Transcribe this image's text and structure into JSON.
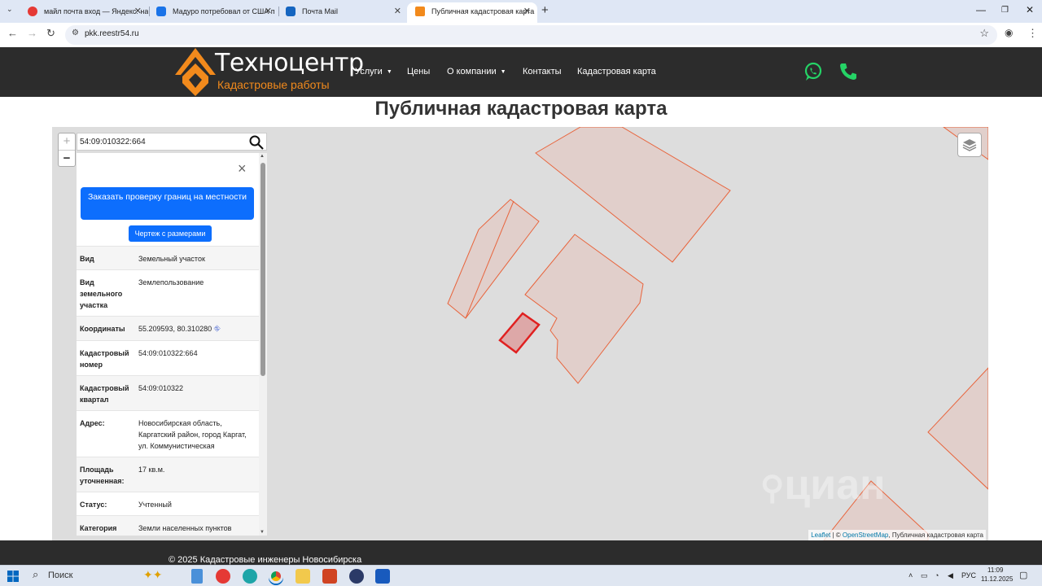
{
  "browser": {
    "tabs": [
      {
        "title": "майл почта вход — Яндекс: на",
        "favicon_color": "#e53935"
      },
      {
        "title": "Мадуро потребовал от США п",
        "favicon_color": "#1a73e8"
      },
      {
        "title": "Почта Mail",
        "favicon_color": "#1565c0"
      },
      {
        "title": "Публичная кадастровая карта",
        "favicon_color": "#f28a1c"
      }
    ],
    "new_tab": "+",
    "url": "pkk.reestr54.ru"
  },
  "site": {
    "logo_title": "Техноцентр",
    "logo_subtitle": "Кадастровые работы",
    "menu": [
      "Услуги",
      "Цены",
      "О компании",
      "Контакты",
      "Кадастровая карта"
    ],
    "page_title": "Публичная кадастровая карта",
    "footer": "© 2025 Кадастровые инженеры Новосибирска"
  },
  "map": {
    "zoom_in": "+",
    "zoom_out": "−",
    "search_value": "54:09:010322:664",
    "watermark": "циан",
    "attribution": {
      "leaflet": "Leaflet",
      "sep": " | © ",
      "osm": "OpenStreetMap",
      "rest": ", Публичная кадастровая карта"
    }
  },
  "panel": {
    "close": "×",
    "order_button": "Заказать проверку границ на местности",
    "drawing_button": "Чертеж с размерами",
    "rows": [
      {
        "key": "Вид",
        "value": "Земельный участок"
      },
      {
        "key": "Вид земельного участка",
        "value": "Землепользование"
      },
      {
        "key": "Координаты",
        "value": "55.209593, 80.310280"
      },
      {
        "key": "Кадастровый номер",
        "value": "54:09:010322:664"
      },
      {
        "key": "Кадастровый квартал",
        "value": "54:09:010322"
      },
      {
        "key": "Адрес:",
        "value": "Новосибирская область, Каргатский район, город Каргат, ул. Коммунистическая"
      },
      {
        "key": "Площадь уточненная:",
        "value": "17 кв.м."
      },
      {
        "key": "Статус:",
        "value": "Учтенный"
      },
      {
        "key": "Категория земель",
        "value": "Земли населенных пунктов"
      }
    ]
  },
  "taskbar": {
    "search": "Поиск",
    "lang": "РУС",
    "time": "11:09",
    "date": "11.12.2025"
  },
  "colors": {
    "header_bg": "#2c2c2c",
    "accent": "#f28a1c",
    "button": "#0d6efd",
    "parcel_stroke": "#e8643c",
    "selected_parcel": "#e02020"
  }
}
